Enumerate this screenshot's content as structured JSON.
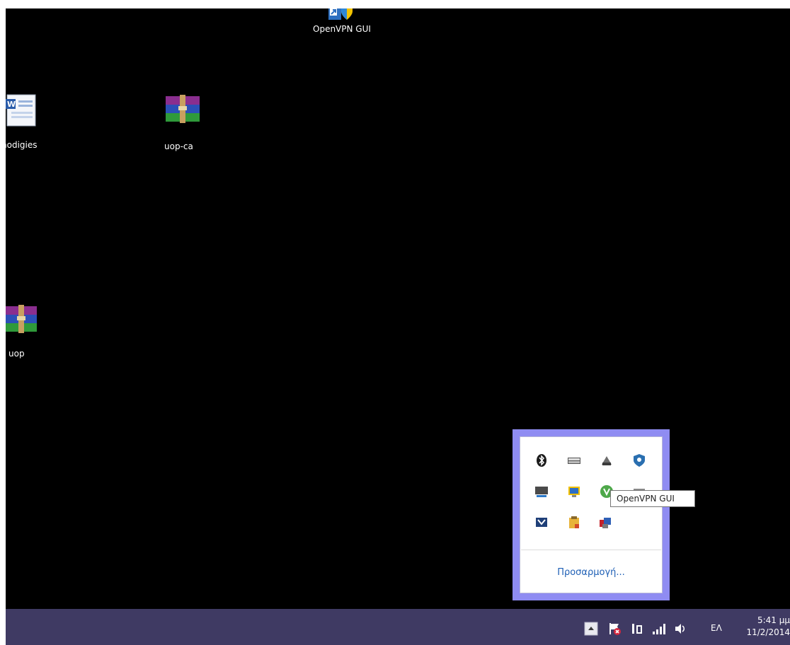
{
  "desktop": {
    "icons": [
      {
        "label": "OpenVPN GUI",
        "icon": "openvpn-shortcut-icon"
      },
      {
        "label": "nodigies",
        "icon": "word-document-icon"
      },
      {
        "label": "uop-ca",
        "icon": "winrar-archive-icon"
      },
      {
        "label": "uop",
        "icon": "winrar-archive-icon"
      }
    ]
  },
  "tray_popup": {
    "icons": [
      "bluetooth-icon",
      "keyboard-icon",
      "network-device-icon",
      "shield-icon",
      "monitor-icon",
      "display-icon",
      "green-app-icon",
      "camera-icon",
      "app-icon",
      "clipboard-icon",
      "openvpn-icon"
    ],
    "tooltip": "OpenVPN GUI",
    "customize_label": "Προσαρμογή..."
  },
  "taskbar": {
    "tray_icons": [
      "show-hidden-icons-arrow",
      "action-center-flag-icon",
      "network-icon",
      "signal-bars-icon",
      "volume-icon"
    ],
    "language": "ΕΛ",
    "time": "5:41 μμ",
    "date": "11/2/2014"
  },
  "colors": {
    "desktop_bg": "#000000",
    "taskbar_bg": "#3f3a63",
    "popup_border": "#8f8cf2",
    "link": "#1e5fb5"
  }
}
